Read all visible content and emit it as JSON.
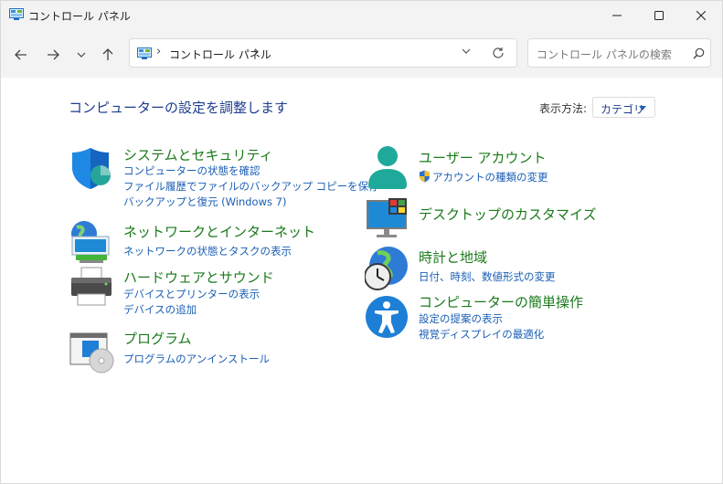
{
  "window": {
    "title": "コントロール パネル"
  },
  "address": {
    "path": "コントロール パネル"
  },
  "search": {
    "placeholder": "コントロール パネルの検索"
  },
  "main": {
    "heading": "コンピューターの設定を調整します",
    "view_label": "表示方法:",
    "view_value": "カテゴリ"
  },
  "categories": [
    {
      "title": "システムとセキュリティ",
      "icon": "shield-icon",
      "links": [
        "コンピューターの状態を確認",
        "ファイル履歴でファイルのバックアップ コピーを保存",
        "バックアップと復元 (Windows 7)"
      ]
    },
    {
      "title": "ネットワークとインターネット",
      "icon": "network-globe-icon",
      "links": [
        "ネットワークの状態とタスクの表示"
      ]
    },
    {
      "title": "ハードウェアとサウンド",
      "icon": "printer-icon",
      "links": [
        "デバイスとプリンターの表示",
        "デバイスの追加"
      ]
    },
    {
      "title": "プログラム",
      "icon": "programs-icon",
      "links": [
        "プログラムのアンインストール"
      ]
    },
    {
      "title": "ユーザー アカウント",
      "icon": "user-icon",
      "links": [
        "アカウントの種類の変更"
      ]
    },
    {
      "title": "デスクトップのカスタマイズ",
      "icon": "monitor-icon",
      "links": []
    },
    {
      "title": "時計と地域",
      "icon": "clock-globe-icon",
      "links": [
        "日付、時刻、数値形式の変更"
      ]
    },
    {
      "title": "コンピューターの簡単操作",
      "icon": "accessibility-icon",
      "links": [
        "設定の提案の表示",
        "視覚ディスプレイの最適化"
      ]
    }
  ]
}
